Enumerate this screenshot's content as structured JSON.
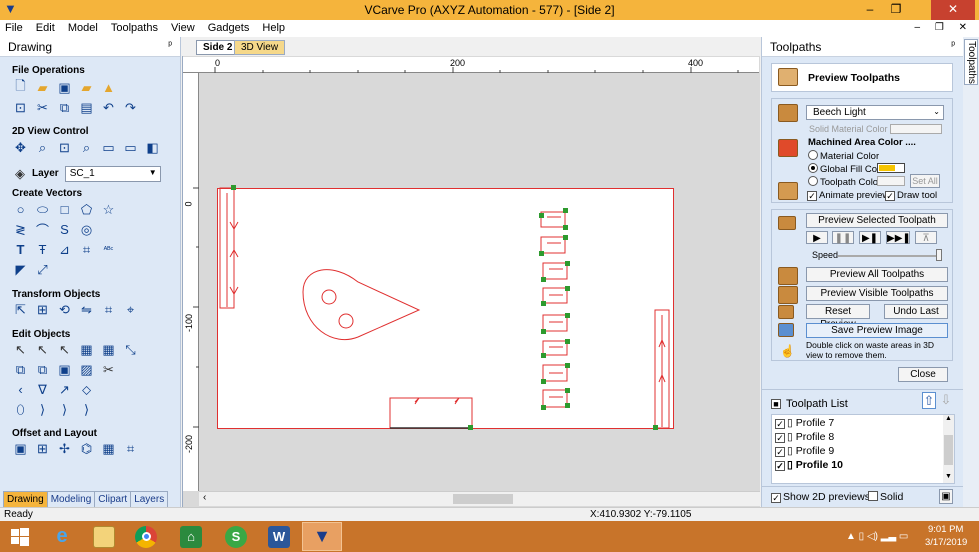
{
  "window": {
    "title": "VCarve Pro (AXYZ Automation - 577) - [Side 2]",
    "min": "–",
    "restore": "❐",
    "close": "✕"
  },
  "menu": [
    "File",
    "Edit",
    "Model",
    "Toolpaths",
    "View",
    "Gadgets",
    "Help"
  ],
  "menu_right": "– ❐ ✕",
  "left_panel": {
    "title": "Drawing",
    "pin": "ᵖ",
    "sections": {
      "file_ops": "File Operations",
      "view_control": "2D View Control",
      "create_vectors": "Create Vectors",
      "transform": "Transform Objects",
      "edit_objects": "Edit Objects",
      "offset_layout": "Offset and Layout"
    },
    "layer_label": "Layer",
    "layer_value": "SC_1",
    "tabs": [
      "Drawing",
      "Modeling",
      "Clipart",
      "Layers"
    ]
  },
  "doc_tabs": [
    "Side 2",
    "3D View"
  ],
  "ruler": {
    "top": [
      "0",
      "200",
      "400"
    ],
    "left": [
      "0",
      "-100",
      "-200"
    ]
  },
  "right_panel": {
    "title": "Toolpaths",
    "vertical_tab": "Toolpaths",
    "preview_toolpaths": "Preview Toolpaths",
    "material": "Beech Light",
    "solid_material_color": "Solid Material Color",
    "machined_area_color": "Machined Area Color ....",
    "material_color": "Material Color",
    "global_fill_color": "Global Fill Color",
    "toolpath_color": "Toolpath Color",
    "set_all": "Set All",
    "animate_preview": "Animate preview",
    "draw_tool": "Draw tool",
    "preview_selected": "Preview Selected Toolpath",
    "speed": "Speed",
    "preview_all": "Preview All Toolpaths",
    "preview_visible": "Preview Visible Toolpaths",
    "reset_preview": "Reset Preview",
    "undo_last": "Undo Last",
    "save_preview": "Save Preview Image",
    "hint": "Double click on waste areas in 3D view to remove them.",
    "close": "Close",
    "toolpath_list_title": "Toolpath List",
    "toolpaths": [
      "Profile 7",
      "Profile 8",
      "Profile 9",
      "Profile 10"
    ],
    "show_2d_previews": "Show 2D previews",
    "solid": "Solid"
  },
  "status": {
    "left": "Ready",
    "coords": "X:410.9302 Y:-79.1105"
  },
  "taskbar": {
    "time": "9:01 PM",
    "date": "3/17/2019"
  },
  "colors": {
    "title": "#f5b43c",
    "accent": "#f5b43c",
    "panel": "#dde8f6",
    "vector": "#e03030",
    "node": "#2e9a2e",
    "taskbar": "#c8742a"
  }
}
